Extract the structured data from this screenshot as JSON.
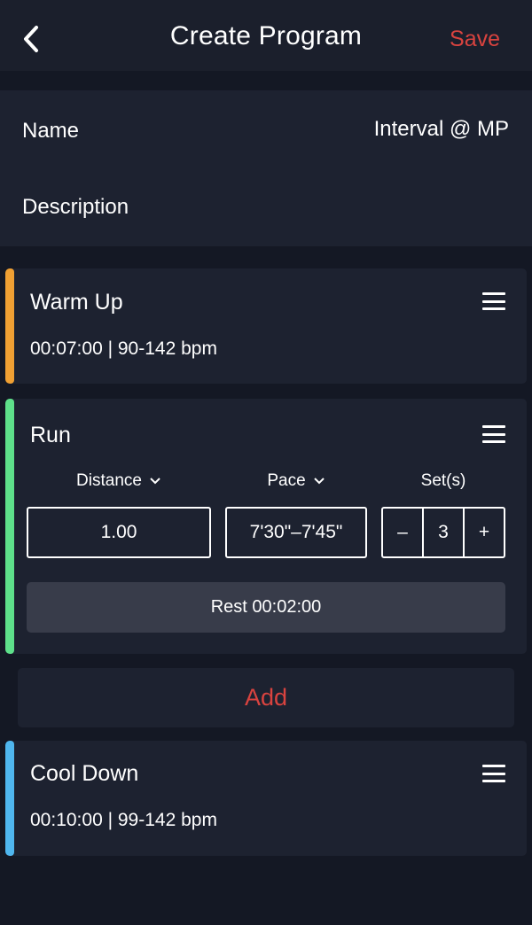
{
  "header": {
    "back_icon": "chevron-left-icon",
    "title": "Create Program",
    "save_label": "Save"
  },
  "info": {
    "name_label": "Name",
    "name_value": "Interval @ MP",
    "description_label": "Description"
  },
  "steps": {
    "warmup": {
      "title": "Warm Up",
      "summary": "00:07:00 | 90-142 bpm",
      "accent_color": "#f0a033",
      "menu_icon": "hamburger-menu-icon"
    },
    "run": {
      "title": "Run",
      "accent_color": "#5ee08a",
      "menu_icon": "hamburger-menu-icon",
      "distance_label": "Distance",
      "pace_label": "Pace",
      "sets_label": "Set(s)",
      "distance_value": "1.00",
      "pace_value": "7'30\"–7'45\"",
      "sets_minus": "–",
      "sets_value": "3",
      "sets_plus": "+",
      "rest_label": "Rest 00:02:00"
    },
    "cooldown": {
      "title": "Cool Down",
      "summary": "00:10:00 | 99-142 bpm",
      "accent_color": "#4fb6ee",
      "menu_icon": "hamburger-menu-icon"
    }
  },
  "add_label": "Add",
  "colors": {
    "background": "#141824",
    "card": "#1d2230",
    "accent_red": "#d9433f",
    "rest_button": "#383c4a"
  }
}
